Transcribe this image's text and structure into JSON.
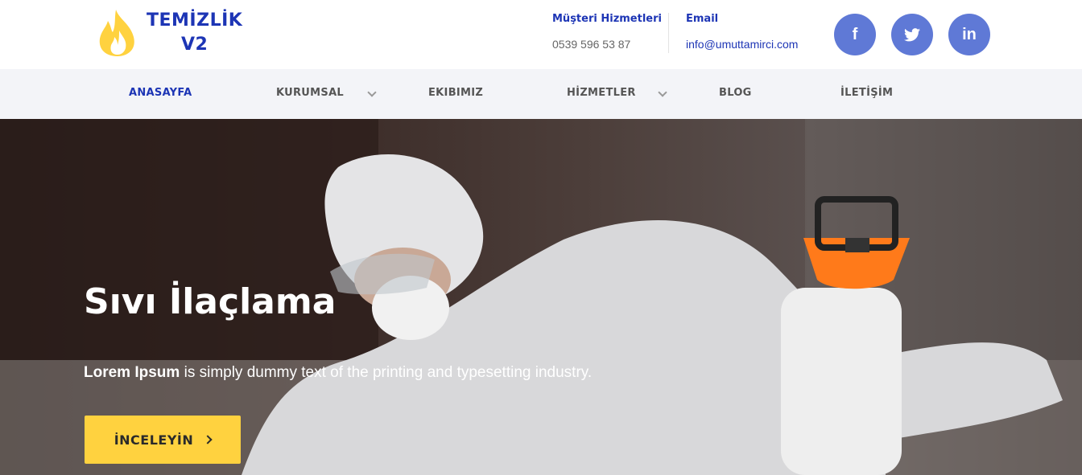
{
  "brand": {
    "line1": "TEMİZLİK",
    "line2": "V2"
  },
  "contact": {
    "phone_label": "Müşteri Hizmetleri",
    "phone_value": "0539 596 53 87",
    "email_label": "Email",
    "email_value": "info@umuttamirci.com"
  },
  "social": {
    "facebook": "f",
    "twitter": "🐦",
    "linkedin": "in"
  },
  "nav": {
    "items": [
      {
        "label": "ANASAYFA"
      },
      {
        "label": "KURUMSAL"
      },
      {
        "label": "EKIBIMIZ"
      },
      {
        "label": "HİZMETLER"
      },
      {
        "label": "BLOG"
      },
      {
        "label": "İLETİŞİM"
      }
    ]
  },
  "hero": {
    "title": "Sıvı İlaçlama",
    "text_bold": "Lorem Ipsum",
    "text_rest": " is simply dummy text of the printing and typesetting industry.",
    "button_label": "İNCELEYİN"
  },
  "colors": {
    "brand_blue": "#1d35b5",
    "social_bg": "#5f79d6",
    "button_yellow": "#ffd23f",
    "nav_bg": "#f3f4f8"
  }
}
